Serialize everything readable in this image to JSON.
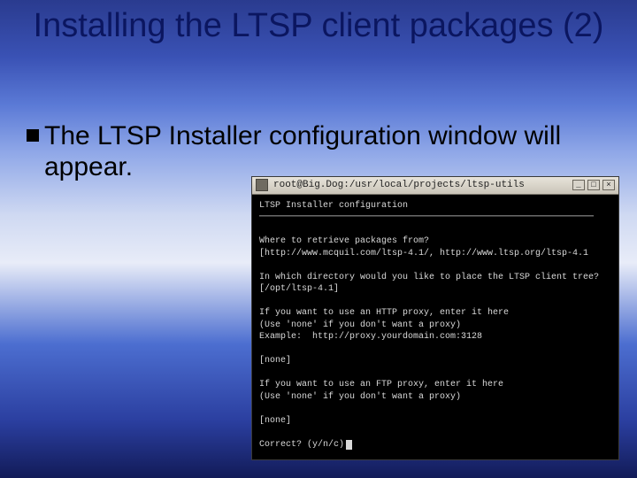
{
  "slide": {
    "title": "Installing the LTSP client packages (2)",
    "bullet": "The LTSP Installer configuration window will appear."
  },
  "terminal": {
    "title": "root@Big.Dog:/usr/local/projects/ltsp-utils",
    "btn_min": "_",
    "btn_max": "□",
    "btn_close": "×",
    "lines": {
      "l0": "LTSP Installer configuration",
      "l1": "───────────────────────────────────────────────────────────────",
      "l2": "Where to retrieve packages from?",
      "l3": "[http://www.mcquil.com/ltsp-4.1/, http://www.ltsp.org/ltsp-4.1",
      "l4": "In which directory would you like to place the LTSP client tree?",
      "l5": "[/opt/ltsp-4.1]",
      "l6": "If you want to use an HTTP proxy, enter it here",
      "l7": "(Use 'none' if you don't want a proxy)",
      "l8": "Example:  http://proxy.yourdomain.com:3128",
      "l9": "[none]",
      "l10": "If you want to use an FTP proxy, enter it here",
      "l11": "(Use 'none' if you don't want a proxy)",
      "l12": "[none]",
      "l13": "Correct? (y/n/c)"
    }
  }
}
